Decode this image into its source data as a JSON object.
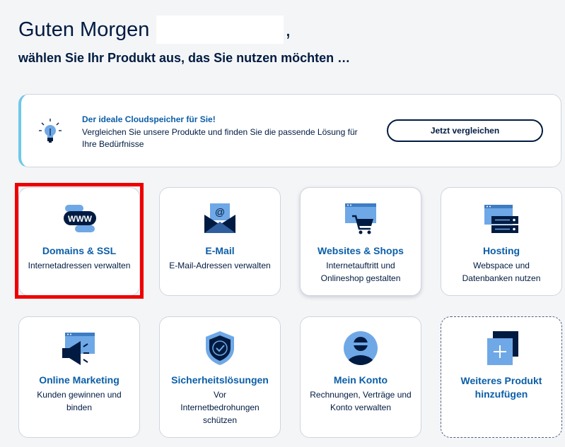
{
  "greeting": {
    "text": "Guten Morgen",
    "suffix": ","
  },
  "subtitle": "wählen Sie Ihr Produkt aus, das Sie nutzen möchten …",
  "promo": {
    "icon": "lightbulb-icon",
    "title": "Der ideale Cloudspeicher für Sie!",
    "text": "Vergleichen Sie unsere Produkte und finden Sie die passende Lösung für Ihre Bedürfnisse",
    "button_label": "Jetzt vergleichen",
    "accent": "#6fc8e8"
  },
  "tiles": [
    {
      "icon": "www-domain-icon",
      "title": "Domains & SSL",
      "desc": "Internetadressen verwalten"
    },
    {
      "icon": "email-icon",
      "title": "E-Mail",
      "desc": "E-Mail-Adressen verwalten"
    },
    {
      "icon": "shopping-cart-icon",
      "title": "Websites & Shops",
      "desc": "Internetauftritt und Onlineshop gestalten"
    },
    {
      "icon": "server-icon",
      "title": "Hosting",
      "desc": "Webspace und Datenbanken nutzen"
    },
    {
      "icon": "megaphone-icon",
      "title": "Online Marketing",
      "desc": "Kunden gewinnen und binden"
    },
    {
      "icon": "shield-check-icon",
      "title": "Sicherheitslösungen",
      "desc": "Vor Internetbedrohungen schützen"
    },
    {
      "icon": "user-avatar-icon",
      "title": "Mein Konto",
      "desc": "Rechnungen, Verträge und Konto verwalten"
    },
    {
      "icon": "plus-icon",
      "title": "Weiteres Produkt hinzufügen",
      "desc": ""
    }
  ],
  "colors": {
    "brand_dark": "#001b41",
    "brand_blue": "#0b5ea8",
    "icon_light_blue": "#6fa8e6",
    "highlight": "#ee0000"
  }
}
